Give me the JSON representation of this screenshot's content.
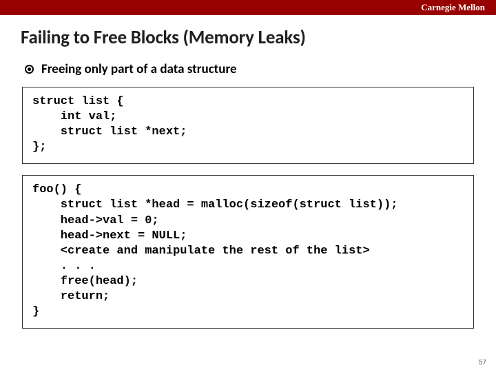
{
  "header": {
    "school": "Carnegie Mellon"
  },
  "slide": {
    "title": "Failing to Free Blocks (Memory Leaks)",
    "bullet": "Freeing only part of a data structure",
    "code1": "struct list {\n    int val;\n    struct list *next;\n};",
    "code2": "foo() {\n    struct list *head = malloc(sizeof(struct list));\n    head->val = 0;\n    head->next = NULL;\n    <create and manipulate the rest of the list>\n    . . .\n    free(head);\n    return;\n}",
    "page_number": "57"
  }
}
